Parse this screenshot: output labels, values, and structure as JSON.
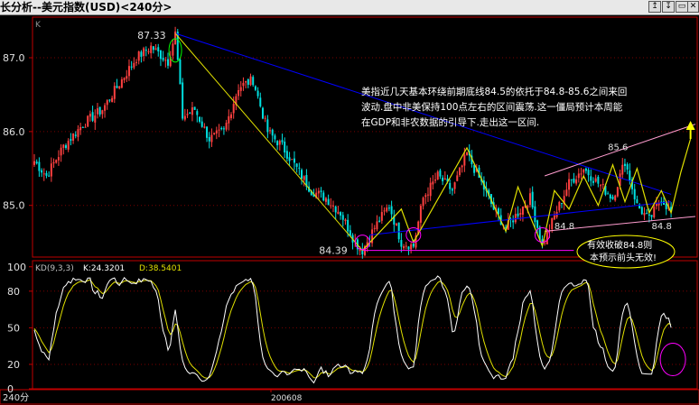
{
  "window": {
    "title": "长分析--美元指数(USD)<240分>",
    "buttons": [
      "↥",
      "↧",
      "▭",
      "✕"
    ]
  },
  "chart_data": [
    {
      "type": "candlestick",
      "panel": "price",
      "ylim": [
        84.3,
        87.55
      ],
      "yticks": [
        "87.0",
        "86.0",
        "85.0"
      ],
      "ytick_values": [
        87.0,
        86.0,
        85.0
      ],
      "corner_label": "K",
      "grid": true,
      "annotations": {
        "high_label": "87.33",
        "low_label": "84.39",
        "right_top_label": "85.6",
        "right_low_label_1": "84.8",
        "right_low_label_2": "84.8",
        "comment": "美指近几天基本环绕前期底线84.5的依托于84.8-85.6之间来回波动.盘中非美保持100点左右的区间震荡.这一僵局预计本周能在GDP和非农数据的引导下.走出这一区间.",
        "comment_lines": [
          "美指近几天基本环绕前期底线84.5的依托于84.8-85.6之间来回",
          "波动.盘中非美保持100点左右的区间震荡.这一僵局预计本周能",
          "在GDP和非农数据的引导下.走出这一区间."
        ],
        "bubble_line_1": "有效收破84.8则",
        "bubble_line_2": "本预示前头无效!"
      },
      "seed": 7,
      "waypoints": [
        [
          0,
          85.6
        ],
        [
          5,
          85.4
        ],
        [
          12,
          85.8
        ],
        [
          20,
          86.1
        ],
        [
          28,
          86.3
        ],
        [
          36,
          86.7
        ],
        [
          42,
          87.0
        ],
        [
          48,
          87.15
        ],
        [
          55,
          86.95
        ],
        [
          58,
          87.33
        ],
        [
          61,
          86.2
        ],
        [
          66,
          86.3
        ],
        [
          72,
          85.9
        ],
        [
          78,
          86.0
        ],
        [
          84,
          86.6
        ],
        [
          90,
          86.7
        ],
        [
          96,
          86.0
        ],
        [
          102,
          85.8
        ],
        [
          108,
          85.5
        ],
        [
          114,
          85.2
        ],
        [
          120,
          85.1
        ],
        [
          126,
          84.9
        ],
        [
          132,
          84.5
        ],
        [
          135,
          84.39
        ],
        [
          140,
          84.7
        ],
        [
          146,
          85.0
        ],
        [
          151,
          84.5
        ],
        [
          156,
          84.45
        ],
        [
          160,
          85.1
        ],
        [
          166,
          85.4
        ],
        [
          172,
          85.2
        ],
        [
          178,
          85.7
        ],
        [
          184,
          85.3
        ],
        [
          189,
          84.95
        ],
        [
          194,
          84.7
        ],
        [
          199,
          84.9
        ],
        [
          204,
          85.1
        ],
        [
          209,
          84.45
        ],
        [
          214,
          84.85
        ],
        [
          220,
          85.3
        ],
        [
          226,
          85.5
        ],
        [
          232,
          85.3
        ],
        [
          238,
          85.1
        ],
        [
          243,
          85.6
        ],
        [
          248,
          85.0
        ],
        [
          253,
          84.8
        ],
        [
          258,
          85.1
        ],
        [
          262,
          84.9
        ]
      ],
      "trendlines": [
        {
          "color": "#0000ff",
          "points": [
            [
              58,
              87.33
            ],
            [
              262,
              85.15
            ]
          ]
        },
        {
          "color": "#0000ff",
          "points": [
            [
              138,
              84.6
            ],
            [
              262,
              85.05
            ]
          ]
        },
        {
          "color": "#e0e000",
          "points": [
            [
              58,
              87.33
            ],
            [
              135,
              84.39
            ]
          ]
        },
        {
          "color": "#ff00ff",
          "points": [
            [
              135,
              84.39
            ],
            [
              222,
              84.39
            ]
          ]
        },
        {
          "color": "#ff9ccf",
          "points": [
            [
              210,
              85.4
            ],
            [
              272,
              86.1
            ]
          ]
        },
        {
          "color": "#ff9ccf",
          "points": [
            [
              210,
              84.65
            ],
            [
              272,
              84.85
            ]
          ]
        }
      ],
      "zigzag": {
        "color": "#e0e000",
        "points": [
          [
            135,
            84.39
          ],
          [
            151,
            84.95
          ],
          [
            156,
            84.5
          ],
          [
            178,
            85.78
          ],
          [
            194,
            84.65
          ],
          [
            199,
            85.25
          ],
          [
            209,
            84.45
          ],
          [
            214,
            85.2
          ],
          [
            220,
            84.95
          ],
          [
            226,
            85.4
          ],
          [
            232,
            85.0
          ],
          [
            238,
            85.55
          ],
          [
            243,
            85.05
          ],
          [
            248,
            85.5
          ],
          [
            253,
            84.9
          ],
          [
            258,
            85.2
          ],
          [
            262,
            84.9
          ],
          [
            266,
            85.45
          ],
          [
            270,
            85.9
          ]
        ]
      }
    },
    {
      "type": "line",
      "panel": "indicator",
      "title": "KD(9,3,3)",
      "k_label": "K:24.3201",
      "d_label": "D:38.5401",
      "ylim": [
        0,
        105
      ],
      "yticks": [
        "100",
        "80",
        "50",
        "20",
        "0"
      ],
      "ytick_values": [
        100,
        80,
        50,
        20,
        0
      ],
      "x_label": "200608",
      "period_label": "240分",
      "series": [
        {
          "name": "K",
          "color": "#ffffff"
        },
        {
          "name": "D",
          "color": "#e0e000"
        }
      ]
    }
  ],
  "colors": {
    "up": "#ff4040",
    "down": "#00e0e0",
    "axis": "#c00000",
    "text": "#e0e0e0",
    "frame": "#c00000"
  }
}
